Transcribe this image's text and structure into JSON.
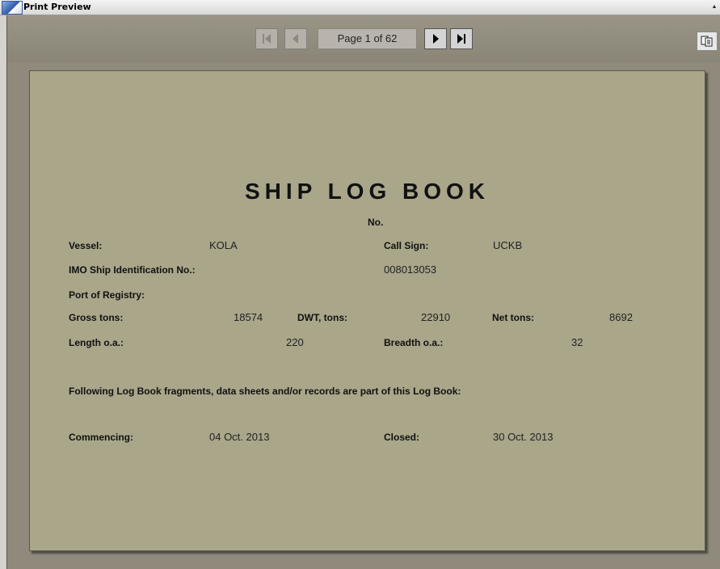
{
  "window": {
    "title": "Print Preview"
  },
  "nav": {
    "page_indicator": "Page 1 of 62",
    "first_icon": "first-page-icon",
    "prev_icon": "previous-page-icon",
    "next_icon": "next-page-icon",
    "last_icon": "last-page-icon",
    "copy_icon": "copy-icon"
  },
  "document": {
    "title": "SHIP LOG BOOK",
    "number_label": "No.",
    "vessel_label": "Vessel:",
    "vessel": "KOLA",
    "call_sign_label": "Call Sign:",
    "call_sign": "UCKB",
    "imo_label": "IMO Ship Identification No.:",
    "imo": "008013053",
    "port_label": "Port of Registry:",
    "gross_label": "Gross tons:",
    "gross": "18574",
    "dwt_label": "DWT, tons:",
    "dwt": "22910",
    "net_label": "Net tons:",
    "net": "8692",
    "length_label": "Length o.a.:",
    "length": "220",
    "breadth_label": "Breadth o.a.:",
    "breadth": "32",
    "fragments_note": "Following Log Book fragments, data sheets and/or records are part of this Log Book:",
    "commencing_label": "Commencing:",
    "commencing": "04 Oct. 2013",
    "closed_label": "Closed:",
    "closed": "30 Oct. 2013"
  },
  "colors": {
    "paper": "#a9a68a",
    "background": "#8f8a7c"
  }
}
